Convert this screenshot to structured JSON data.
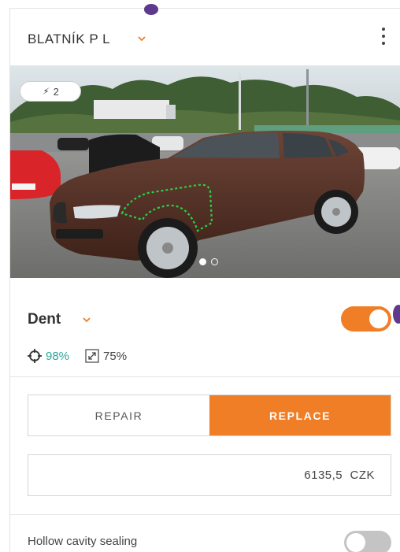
{
  "header": {
    "part_name": "BLATNÍK P L"
  },
  "photo": {
    "badge_count": "2",
    "badge_icon": "bolt-icon",
    "carousel_total": 2,
    "carousel_active": 1
  },
  "damage": {
    "type": "Dent",
    "enabled": true,
    "accuracy": "98%",
    "size": "75%"
  },
  "repair_options": {
    "repair_label": "REPAIR",
    "replace_label": "REPLACE",
    "selected": "replace"
  },
  "price": {
    "value": "6135,5",
    "currency": "CZK"
  },
  "extras": {
    "hollow_cavity_label": "Hollow cavity sealing",
    "hollow_cavity_enabled": false
  },
  "colors": {
    "accent": "#f07e26",
    "accuracy_text": "#2aa79b",
    "toggle_off": "#c4c4c4"
  }
}
